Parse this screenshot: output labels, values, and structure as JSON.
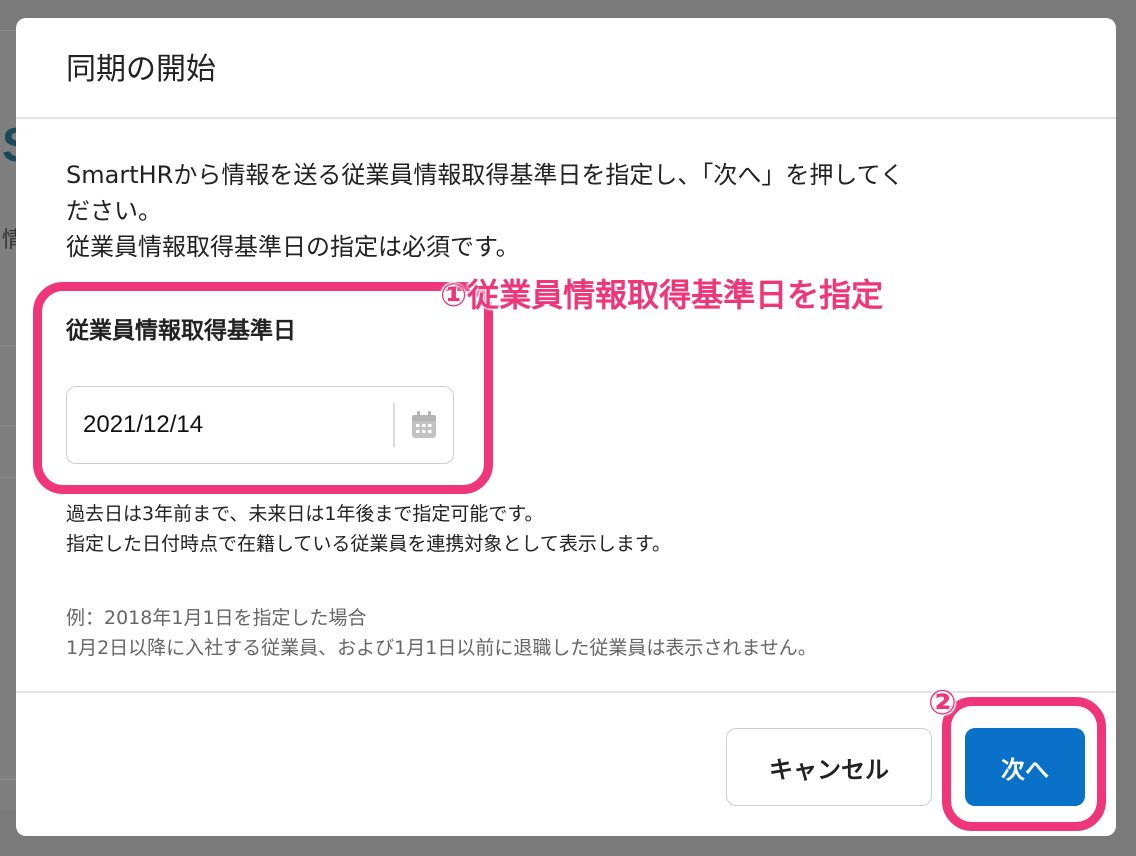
{
  "dialog": {
    "title": "同期の開始",
    "intro_line1": "SmartHRから情報を送る従業員情報取得基準日を指定し、「次へ」を押してく",
    "intro_line2": "ださい。",
    "intro_line3": "従業員情報取得基準日の指定は必須です。",
    "field_label": "従業員情報取得基準日",
    "date_value": "2021/12/14",
    "help_line1": "過去日は3年前まで、未来日は1年後まで指定可能です。",
    "help_line2": "指定した日付時点で在籍している従業員を連携対象として表示します。",
    "example_line1": "例：2018年1月1日を指定した場合",
    "example_line2": "1月2日以降に入社する従業員、および1月1日以前に退職した従業員は表示されません。",
    "cancel_label": "キャンセル",
    "next_label": "次へ"
  },
  "annotations": {
    "step1": "①従業員情報取得基準日を指定",
    "step2": "②",
    "highlight_color": "#f0367a"
  },
  "background": {
    "letter": "S",
    "char": "情"
  },
  "colors": {
    "primary": "#0a71c8",
    "overlay": "#7a7a7a"
  },
  "icons": {
    "calendar": "calendar-icon"
  }
}
